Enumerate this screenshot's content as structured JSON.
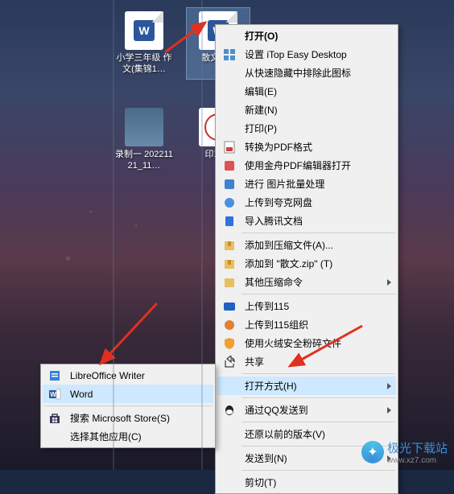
{
  "desktop": {
    "icons": [
      {
        "label": "小学三年级\n作文(集锦1…",
        "badge": "W",
        "selected": false
      },
      {
        "label": "散文.c…",
        "badge": "W",
        "selected": true
      }
    ],
    "icons2": [
      {
        "label": "录制一\n20221121_11…",
        "type": "thumb"
      },
      {
        "label": "印章…",
        "type": "stamp"
      }
    ]
  },
  "main_menu": {
    "open": "打开(O)",
    "itop": "设置 iTop Easy Desktop",
    "hide_icon": "从快速隐藏中排除此图标",
    "edit": "编辑(E)",
    "new": "新建(N)",
    "print": "打印(P)",
    "to_pdf": "转换为PDF格式",
    "jz_pdf": "使用金舟PDF编辑器打开",
    "batch_img": "进行 图片批量处理",
    "kk_cloud": "上传到夸克网盘",
    "tencent_doc": "导入腾讯文档",
    "add_zip_a": "添加到压缩文件(A)...",
    "add_zip_t": "添加到 \"散文.zip\" (T)",
    "other_zip": "其他压缩命令",
    "upload_115": "上传到115",
    "upload_115_org": "上传到115组织",
    "huorong": "使用火绒安全粉碎文件",
    "share": "共享",
    "open_with": "打开方式(H)",
    "qq_send": "通过QQ发送到",
    "restore": "还原以前的版本(V)",
    "send_to": "发送到(N)",
    "cut": "剪切(T)"
  },
  "sub_menu": {
    "libre": "LibreOffice Writer",
    "word": "Word",
    "store": "搜索 Microsoft Store(S)",
    "other": "选择其他应用(C)"
  },
  "watermark": {
    "site": "极光下载站",
    "url": "www.xz7.com"
  }
}
